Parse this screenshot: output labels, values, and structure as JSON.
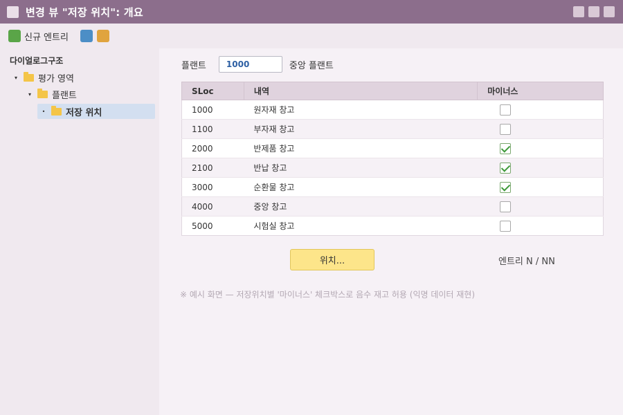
{
  "window": {
    "title": "변경 뷰 \"저장 위치\": 개요"
  },
  "toolbar": {
    "new_entries_label": "신규 엔트리"
  },
  "sidebar": {
    "title": "다이얼로그구조",
    "tree": [
      {
        "label": "평가 영역",
        "toggle": "▾"
      },
      {
        "label": "플랜트",
        "toggle": "▾"
      },
      {
        "label": "저장 위치",
        "toggle": "•",
        "selected": true
      }
    ]
  },
  "main": {
    "plant_label": "플랜트",
    "plant_value": "1000",
    "plant_desc": "중앙 플랜트",
    "table": {
      "headers": [
        "SLoc",
        "내역",
        "마이너스"
      ],
      "rows": [
        {
          "sloc": "1000",
          "desc": "원자재 창고",
          "negative": false
        },
        {
          "sloc": "1100",
          "desc": "부자재 창고",
          "negative": false
        },
        {
          "sloc": "2000",
          "desc": "반제품 창고",
          "negative": true
        },
        {
          "sloc": "2100",
          "desc": "반납 창고",
          "negative": true
        },
        {
          "sloc": "3000",
          "desc": "순환물 창고",
          "negative": true
        },
        {
          "sloc": "4000",
          "desc": "중앙 창고",
          "negative": false
        },
        {
          "sloc": "5000",
          "desc": "시험실 창고",
          "negative": false
        }
      ]
    },
    "position_button": "위치...",
    "entry_count": "엔트리 N / NN",
    "footnote": "※ 예시 화면 — 저장위치별 '마이너스' 체크박스로 음수 재고 허용 (익명 데이터 재현)"
  },
  "colors": {
    "titlebar": "#8c6e8c",
    "selected_node": "#d3dff0",
    "position_button": "#fde58a",
    "check_green": "#3e9a3a"
  },
  "icons": [
    "window-icon",
    "new-entries-icon",
    "blue-action-icon",
    "orange-action-icon",
    "folder-icon",
    "checkbox-icon"
  ]
}
